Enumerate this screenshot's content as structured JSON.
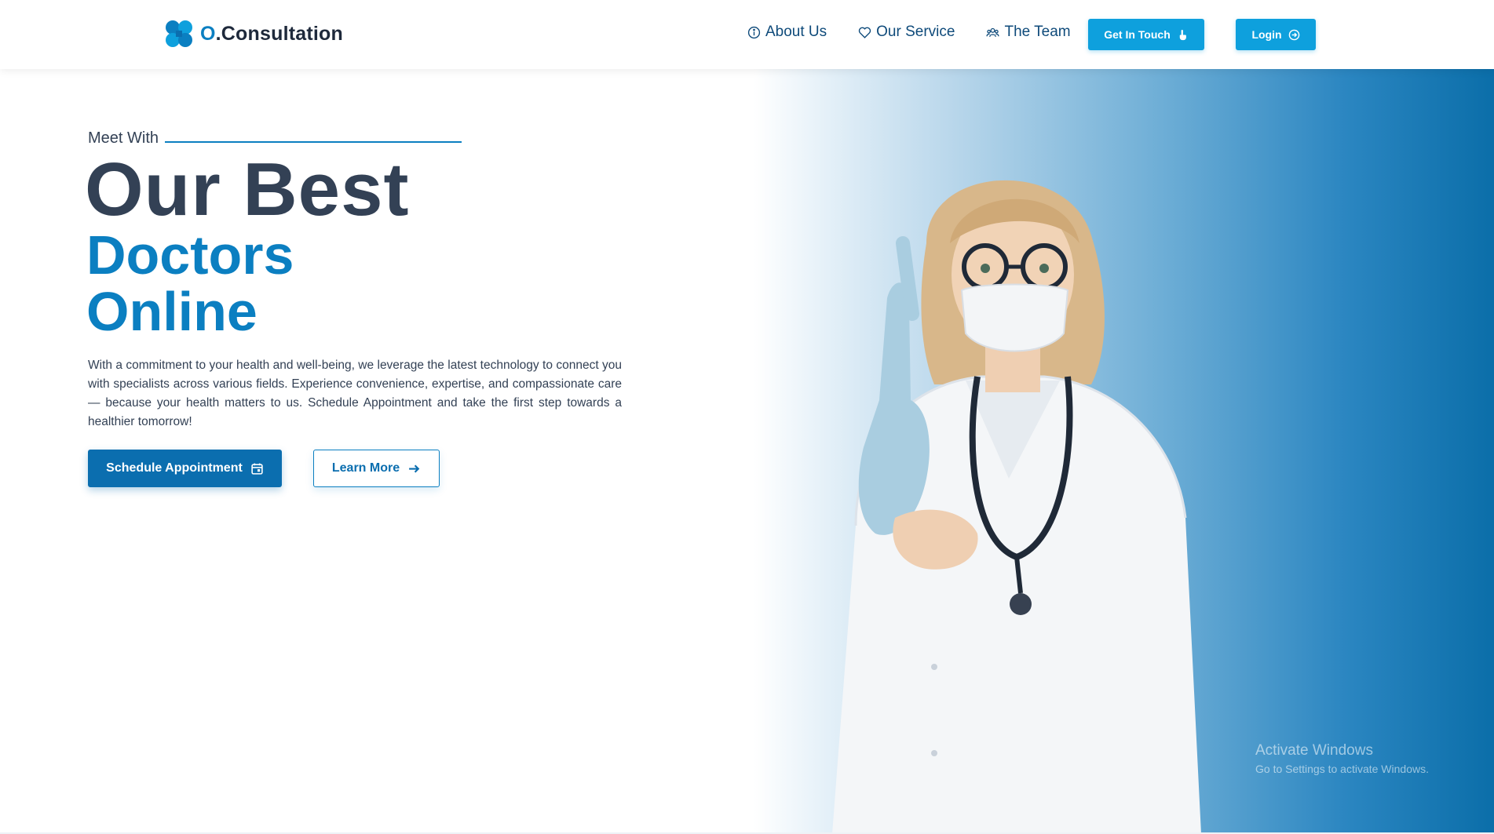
{
  "brand": {
    "accent": "O",
    "name": ".Consultation",
    "logo_icon": "clover-logo-icon"
  },
  "nav": {
    "links": [
      {
        "label": "About Us",
        "icon": "info-icon"
      },
      {
        "label": "Our Service",
        "icon": "heart-icon"
      },
      {
        "label": "The Team",
        "icon": "team-icon"
      }
    ],
    "get_in_touch": "Get In Touch",
    "login": "Login"
  },
  "hero": {
    "meet": "Meet With",
    "title_line1": "Our Best",
    "title_line2": "Doctors",
    "title_line3": "Online",
    "description": "With a commitment to your health and well-being, we leverage the latest technology to connect you with specialists across various fields. Experience convenience, expertise, and compassionate care — because your health matters to us. Schedule Appointment and take the first step towards a healthier tomorrow!",
    "schedule_button": "Schedule Appointment",
    "learn_button": "Learn More"
  },
  "watermark": {
    "line1": "Activate Windows",
    "line2": "Go to Settings to activate Windows."
  },
  "colors": {
    "primary": "#0b7fc1",
    "button": "#0ea0dd",
    "dark_button": "#0b6eaf",
    "heading": "#334155"
  }
}
